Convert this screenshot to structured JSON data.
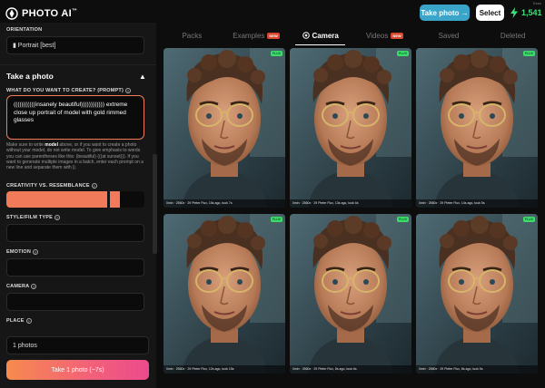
{
  "header": {
    "logo_text": "PHOTO AI",
    "logo_tm": "™",
    "take_photo_label": "Take photo →",
    "select_label": "Select",
    "credits": "1,541",
    "status_text": "Exec"
  },
  "left_panel": {
    "orientation_label": "ORIENTATION",
    "orientation_value": "▮ Portrait [best]",
    "section_title": "Take a photo",
    "prompt_label": "WHAT DO YOU WANT TO CREATE? (PROMPT)",
    "prompt_value": "(((((((((((insanely beautiful)))))))))))) extreme close up portrait of model with gold rimmed glasses",
    "hint_pre": "Make sure to write ",
    "hint_model": "model",
    "hint_post": " above, or if you want to create a photo without your model, do not write model. To give emphasis to words you can use parentheses like this: (beautiful) (((at sunset))). If you want to generate multiple images in a batch, enter each prompt on a new line and separate them with ||.",
    "creativity_label": "CREATIVITY VS. RESEMBLANCE",
    "creativity_level_percent": 73,
    "style_label": "STYLE/FILM TYPE",
    "emotion_label": "EMOTION",
    "camera_label": "CAMERA",
    "place_label": "PLACE",
    "photo_count": "1 photos",
    "cta_label": "Take 1 photo (~7s)"
  },
  "tabs": [
    {
      "label": "Packs",
      "badge": "",
      "active": false
    },
    {
      "label": "Examples",
      "badge": "NEW",
      "active": false
    },
    {
      "label": "Camera",
      "badge": "",
      "active": true
    },
    {
      "label": "Videos",
      "badge": "NEW",
      "active": false
    },
    {
      "label": "Saved",
      "badge": "",
      "active": false
    },
    {
      "label": "Deleted",
      "badge": "",
      "active": false
    }
  ],
  "gallery": [
    {
      "badge": "FLUX",
      "caption": "0min · 2560x · 29 Pieter Flux, 15s ago, took 7s"
    },
    {
      "badge": "FLUX",
      "caption": "0min · 2560x · 29 Pieter Flux, 13s ago, took 6s"
    },
    {
      "badge": "FLUX",
      "caption": "0min · 2560x · 29 Pieter Flux, 14s ago, took 5s"
    },
    {
      "badge": "FLUX",
      "caption": "0min · 2560x · 29 Pieter Flux, 12s ago, took 15s"
    },
    {
      "badge": "FLUX",
      "caption": "0min · 2560x · 29 Pieter Flux, 8s ago, took 6s"
    },
    {
      "badge": "FLUX",
      "caption": "0min · 2560x · 29 Pieter Flux, 8s ago, took 5s"
    }
  ],
  "colors": {
    "accent": "#3aa4c9",
    "credits_green": "#3ee07a",
    "prompt_border": "#f27b56",
    "badge_new": "#d9472f",
    "flux_badge": "#3fdc6a"
  },
  "icons": {
    "logo": "photo-ai-logo-icon",
    "credits": "lightning-bolt-icon",
    "camera_tab": "camera-icon",
    "collapse": "chevron-up-icon",
    "help": "help-circle-icon"
  }
}
